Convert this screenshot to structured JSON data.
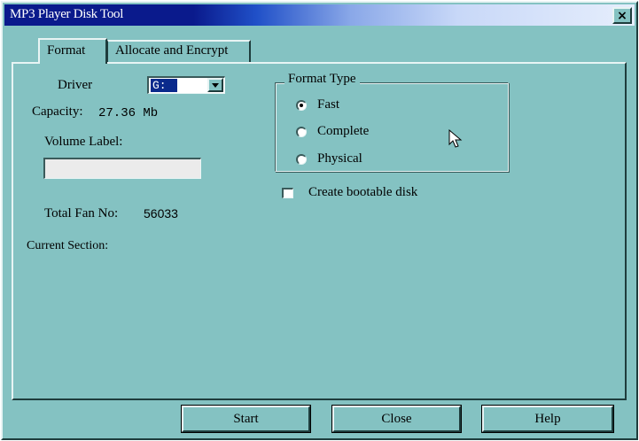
{
  "window": {
    "title": "MP3 Player Disk Tool",
    "close_glyph": "×"
  },
  "tabs": [
    {
      "label": "Format",
      "active": true
    },
    {
      "label": "Allocate and Encrypt",
      "active": false
    }
  ],
  "format": {
    "driver_label": "Driver",
    "driver_value": "G:",
    "capacity_label": "Capacity:",
    "capacity_value": "27.36 Mb",
    "volume_label_label": "Volume Label:",
    "volume_label_value": "",
    "total_fan_label": "Total Fan No:",
    "total_fan_value": "56033",
    "current_section_label": "Current Section:"
  },
  "format_type": {
    "title": "Format Type",
    "options": [
      {
        "label": "Fast",
        "checked": true
      },
      {
        "label": "Complete",
        "checked": false
      },
      {
        "label": "Physical",
        "checked": false
      }
    ]
  },
  "bootable": {
    "label": "Create bootable disk",
    "checked": false
  },
  "buttons": {
    "start": "Start",
    "close": "Close",
    "help": "Help"
  },
  "icons": {
    "close": "close-icon",
    "dropdown": "chevron-down-icon",
    "cursor": "mouse-pointer-icon"
  },
  "colors": {
    "window_bg": "#84c2c2",
    "title_bar": "#0a1a8c",
    "selection": "#0a2a8c"
  }
}
